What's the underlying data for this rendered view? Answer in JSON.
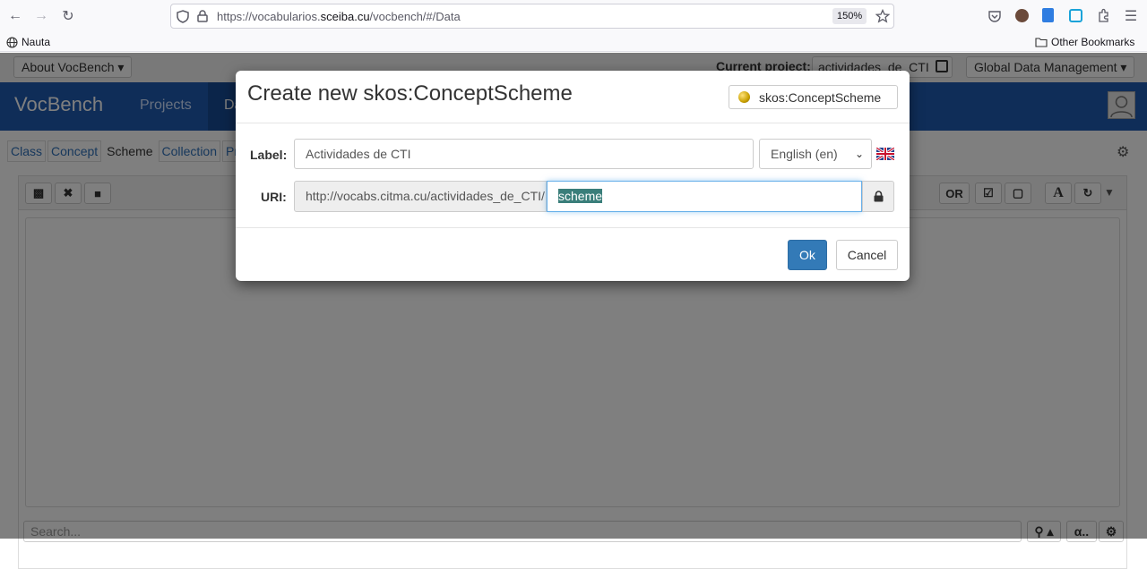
{
  "browser": {
    "url_prefix": "https://vocabularios.",
    "url_domain": "sceiba.cu",
    "url_path": "/vocbench/#/Data",
    "zoom": "150%",
    "bookmarks": {
      "left_item": "Nauta",
      "right_item": "Other Bookmarks"
    }
  },
  "app": {
    "about_menu": "About VocBench",
    "current_project_label": "Current project:",
    "current_project": "actividades_de_CTI",
    "global_menu": "Global Data Management",
    "brand": "VocBench",
    "nav": [
      "Projects",
      "Da"
    ],
    "tabs": [
      "Class",
      "Concept",
      "Scheme",
      "Collection",
      "Pro"
    ],
    "active_tab": "Scheme",
    "toolbar_right": {
      "or_label": "OR",
      "font_label": "A"
    },
    "search_placeholder": "Search...",
    "alpha_label": "α.."
  },
  "modal": {
    "title": "Create new skos:ConceptScheme",
    "type_badge": "skos:ConceptScheme",
    "label_caption": "Label:",
    "label_value": "Actividades de CTI",
    "language": "English (en)",
    "uri_caption": "URI:",
    "uri_prefix": "http://vocabs.citma.cu/actividades_de_CTI/",
    "uri_local": "scheme",
    "ok_label": "Ok",
    "cancel_label": "Cancel"
  },
  "colors": {
    "navbar": "#1e5ab0",
    "primary_button": "#337ab7",
    "selection": "#3a7e7a"
  }
}
